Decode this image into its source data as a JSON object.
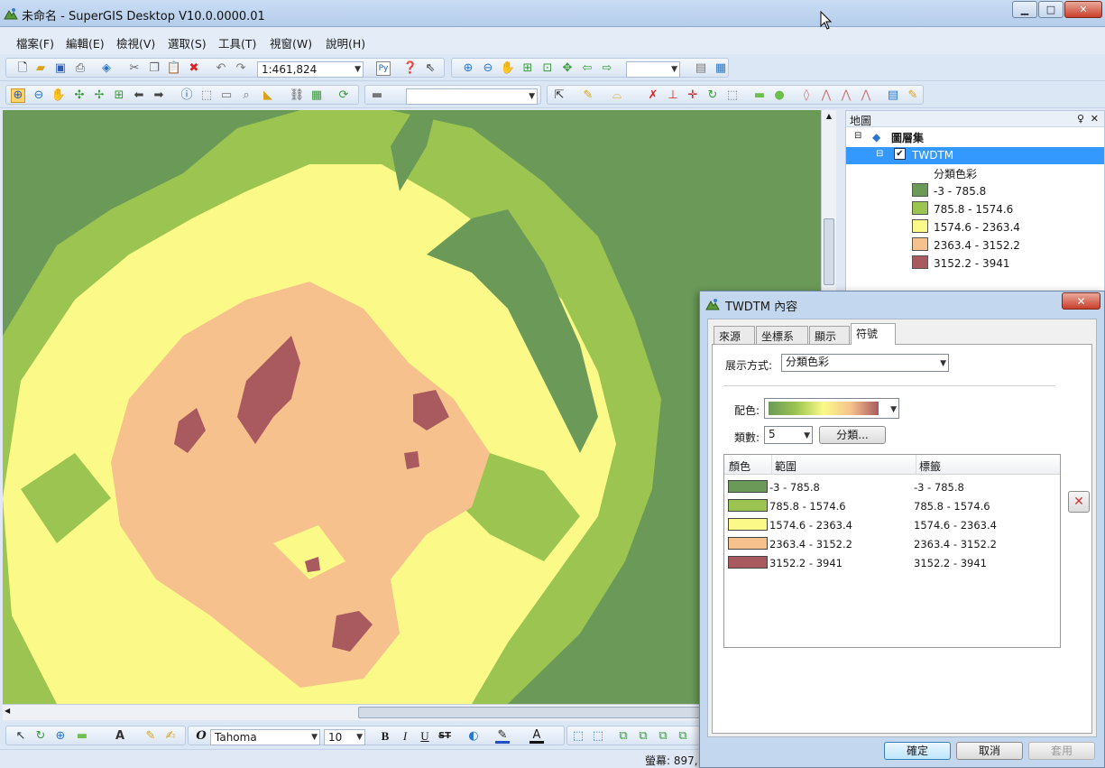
{
  "window": {
    "title": "未命名 - SuperGIS Desktop V10.0.0000.01"
  },
  "menu": [
    "檔案(F)",
    "編輯(E)",
    "檢視(V)",
    "選取(S)",
    "工具(T)",
    "視窗(W)",
    "說明(H)"
  ],
  "toolbar": {
    "scale": "1:461,824",
    "font": "Tahoma",
    "font_size": "10",
    "format_btns": [
      "B",
      "I",
      "U",
      "ST"
    ]
  },
  "panel": {
    "title": "地圖",
    "pin": "♀",
    "close": "✕",
    "root": "圖層集",
    "layer": "TWDTM",
    "renderer": "分類色彩",
    "classes": [
      {
        "label": "-3 - 785.8",
        "color": "#6b9a58"
      },
      {
        "label": "785.8 - 1574.6",
        "color": "#9cc450"
      },
      {
        "label": "1574.6 - 2363.4",
        "color": "#fbfa88"
      },
      {
        "label": "2363.4 - 3152.2",
        "color": "#f6c18c"
      },
      {
        "label": "3152.2 - 3941",
        "color": "#a85a5e"
      }
    ]
  },
  "status": {
    "text": "螢幕: 897,"
  },
  "dialog": {
    "title": "TWDTM 內容",
    "tabs": [
      "來源",
      "坐標系統",
      "顯示",
      "符號"
    ],
    "display_label": "展示方式:",
    "display_value": "分類色彩",
    "ramp_label": "配色:",
    "count_label": "類數:",
    "count_value": "5",
    "classify_button": "分類...",
    "columns": [
      "顏色",
      "範圍",
      "標籤"
    ],
    "rows": [
      {
        "range": "-3 - 785.8",
        "label": "-3 - 785.8",
        "color": "#6b9a58"
      },
      {
        "range": "785.8 - 1574.6",
        "label": "785.8 - 1574.6",
        "color": "#9cc450"
      },
      {
        "range": "1574.6 - 2363.4",
        "label": "1574.6 - 2363.4",
        "color": "#fbfa88"
      },
      {
        "range": "2363.4 - 3152.2",
        "label": "2363.4 - 3152.2",
        "color": "#f6c18c"
      },
      {
        "range": "3152.2 - 3941",
        "label": "3152.2 - 3941",
        "color": "#a85a5e"
      }
    ],
    "ok": "確定",
    "cancel": "取消",
    "apply": "套用"
  }
}
